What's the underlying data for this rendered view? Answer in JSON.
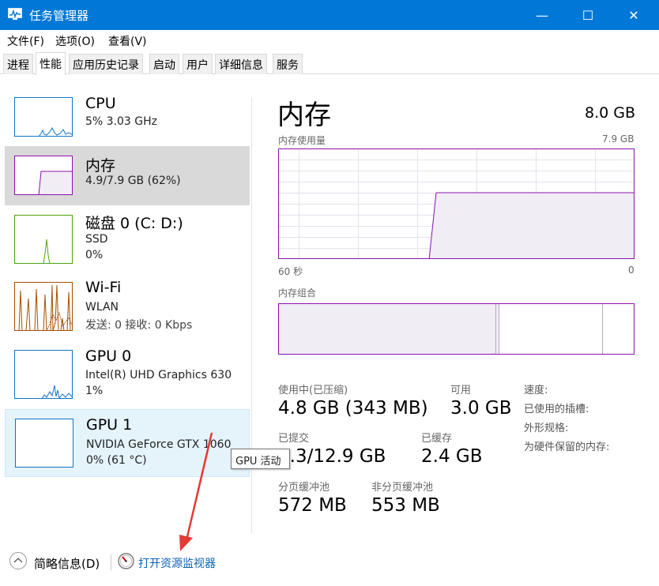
{
  "window": {
    "title": "任务管理器",
    "controls": {
      "minimize": "—",
      "maximize": "☐",
      "close": "✕"
    }
  },
  "menu": [
    "文件(F)",
    "选项(O)",
    "查看(V)"
  ],
  "tabs": [
    "进程",
    "性能",
    "应用历史记录",
    "启动",
    "用户",
    "详细信息",
    "服务"
  ],
  "active_tab": "性能",
  "sidebar": [
    {
      "title": "CPU",
      "line1": "5% 3.03 GHz",
      "line2": "",
      "color": "#1174c7"
    },
    {
      "title": "内存",
      "line1": "4.9/7.9 GB (62%)",
      "line2": "",
      "color": "#8b12ae",
      "usage": 0.62
    },
    {
      "title": "磁盘 0 (C: D:)",
      "line1": "SSD",
      "line2": "0%",
      "color": "#4da60c"
    },
    {
      "title": "Wi-Fi",
      "line1": "WLAN",
      "line2": "发送: 0 接收: 0 Kbps",
      "color": "#a74f01"
    },
    {
      "title": "GPU 0",
      "line1": "Intel(R) UHD Graphics 630",
      "line2": "1%",
      "color": "#1174c7"
    },
    {
      "title": "GPU 1",
      "line1": "NVIDIA GeForce GTX 1060",
      "line2": "0% (61 °C)",
      "color": "#1174c7"
    }
  ],
  "tooltip": "GPU 活动",
  "main": {
    "title": "内存",
    "total": "8.0 GB",
    "usage_label": "内存使用量",
    "usage_max": "7.9 GB",
    "axis_left": "60 秒",
    "axis_right": "0",
    "composition_label": "内存组合",
    "accent": "#8b12ae",
    "fill": "#f1edf5"
  },
  "stats": {
    "in_use_label": "使用中(已压缩)",
    "in_use": "4.8 GB (343 MB)",
    "available_label": "可用",
    "available": "3.0 GB",
    "committed_label": "已提交",
    "committed": "5.3/12.9 GB",
    "cached_label": "已缓存",
    "cached": "2.4 GB",
    "paged_label": "分页缓冲池",
    "paged": "572 MB",
    "nonpaged_label": "非分页缓冲池",
    "nonpaged": "553 MB"
  },
  "right_labels": [
    "速度:",
    "已使用的插槽:",
    "外形规格:",
    "为硬件保留的内存:"
  ],
  "bottom": {
    "fewer_details": "简略信息(D)",
    "resource_monitor": "打开资源监视器"
  }
}
